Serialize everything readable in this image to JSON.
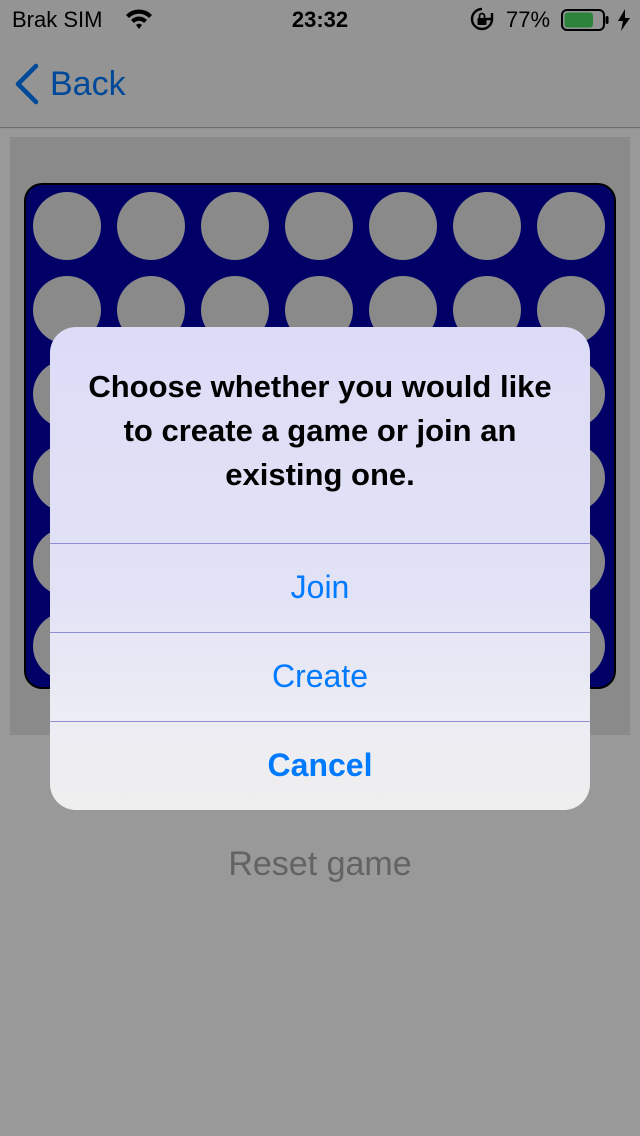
{
  "status_bar": {
    "carrier": "Brak SIM",
    "time": "23:32",
    "battery_percent": "77%",
    "battery_level": 0.77,
    "icons": [
      "wifi-icon",
      "orientation-lock-icon",
      "battery-icon",
      "charging-bolt-icon"
    ]
  },
  "nav": {
    "back_label": "Back",
    "back_icon": "chevron-left-icon"
  },
  "board": {
    "columns": 7,
    "rows": 6,
    "board_color": "#0000aa",
    "empty_cell_color": "#e6e6e6"
  },
  "reset_label": "Reset game",
  "alert": {
    "message": "Choose whether you would like to create a game or join an existing one.",
    "buttons": [
      {
        "label": "Join",
        "style": "default"
      },
      {
        "label": "Create",
        "style": "default"
      },
      {
        "label": "Cancel",
        "style": "cancel"
      }
    ]
  },
  "colors": {
    "accent": "#007aff",
    "overlay": "rgba(0,0,0,0.4)"
  }
}
